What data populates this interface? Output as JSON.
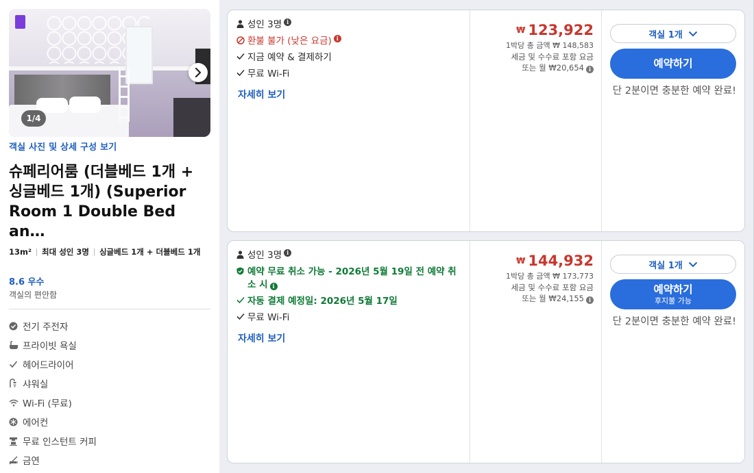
{
  "room": {
    "photo_counter": "1/4",
    "photo_link": "객실 사진 및 상세 구성 보기",
    "title": "슈페리어룸 (더블베드 1개 + 싱글베드 1개) (Superior Room 1 Double Bed an…",
    "specs": [
      "13m²",
      "최대 성인 3명",
      "싱글베드 1개 + 더블베드 1개"
    ],
    "rating": "8.6 우수",
    "rating_sub": "객실의 편안함",
    "amenities": [
      {
        "icon": "ebike-icon",
        "label": "전기 주전자"
      },
      {
        "icon": "bathtub-icon",
        "label": "프라이빗 욕실"
      },
      {
        "icon": "check-icon",
        "label": "헤어드라이어"
      },
      {
        "icon": "shower-icon",
        "label": "샤워실"
      },
      {
        "icon": "wifi-icon",
        "label": "Wi-Fi (무료)"
      },
      {
        "icon": "snowflake-icon",
        "label": "에어컨"
      },
      {
        "icon": "coffee-machine-icon",
        "label": "무료 인스턴트 커피"
      },
      {
        "icon": "no-smoking-icon",
        "label": "금연"
      }
    ]
  },
  "rates": [
    {
      "guests": "성인 3명",
      "policy": "환불 불가 (낮은 요금)",
      "perks": [
        "지금 예약 & 결제하기",
        "무료 Wi-Fi"
      ],
      "details": "자세히 보기",
      "currency": "₩",
      "price": "123,922",
      "per_night": "1박당 총 금액 ₩ 148,583",
      "tax_note": "세금 및 수수료 포함 요금",
      "monthly": "또는 월 ₩20,654",
      "room_select": "객실 1개",
      "book_label": "예약하기",
      "book_note": "단 2분이면 충분한 예약 완료!"
    },
    {
      "guests": "성인 3명",
      "policy": "예약 무료 취소 가능 - 2026년 5월 19일 전 예약 취소 시",
      "perks_green": "자동 결제 예정일: 2026년 5월 17일",
      "perks": [
        "무료 Wi-Fi"
      ],
      "details": "자세히 보기",
      "currency": "₩",
      "price": "144,932",
      "per_night": "1박당 총 금액 ₩ 173,773",
      "tax_note": "세금 및 수수료 포함 요금",
      "monthly": "또는 월 ₩24,155",
      "room_select": "객실 1개",
      "book_label": "예약하기",
      "book_sub": "후지불 가능",
      "book_note": "단 2분이면 충분한 예약 완료!"
    }
  ],
  "colors": {
    "accent": "#2a6ddc",
    "link": "#1f5fbf",
    "price": "#c8372d",
    "free_cancel": "#0f7a36",
    "tag": "#7a3ddb"
  }
}
